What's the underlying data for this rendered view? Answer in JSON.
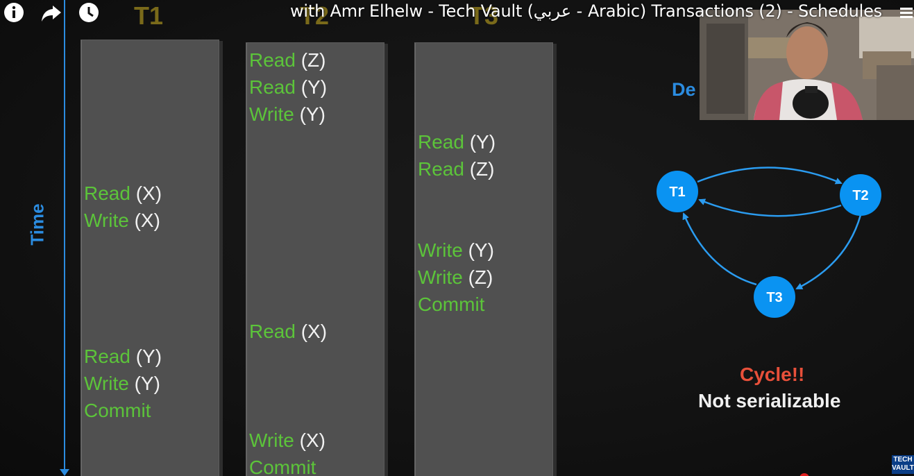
{
  "overlay": {
    "title": "with Amr Elhelw - Tech Vault (عربي - Arabic) Transactions (2) - Schedules",
    "icons": [
      "info-icon",
      "share-icon",
      "watch-later-icon",
      "menu-icon"
    ]
  },
  "time_label": "Time",
  "dependency_label": "De",
  "columns": [
    {
      "header": "T1",
      "ops": [
        {
          "verb": "Read",
          "arg": "(X)"
        },
        {
          "verb": "Write",
          "arg": "(X)"
        },
        {
          "verb": "Read",
          "arg": "(Y)"
        },
        {
          "verb": "Write",
          "arg": "(Y)"
        },
        {
          "verb": "Commit",
          "arg": ""
        }
      ]
    },
    {
      "header": "T2",
      "ops": [
        {
          "verb": "Read",
          "arg": "(Z)"
        },
        {
          "verb": "Read",
          "arg": "(Y)"
        },
        {
          "verb": "Write",
          "arg": "(Y)"
        },
        {
          "verb": "Read",
          "arg": "(X)"
        },
        {
          "verb": "Write",
          "arg": "(X)"
        },
        {
          "verb": "Commit",
          "arg": ""
        }
      ]
    },
    {
      "header": "T3",
      "ops": [
        {
          "verb": "Read",
          "arg": "(Y)"
        },
        {
          "verb": "Read",
          "arg": "(Z)"
        },
        {
          "verb": "Write",
          "arg": "(Y)"
        },
        {
          "verb": "Write",
          "arg": "(Z)"
        },
        {
          "verb": "Commit",
          "arg": ""
        }
      ]
    }
  ],
  "graph": {
    "nodes": [
      "T1",
      "T2",
      "T3"
    ],
    "edges": [
      {
        "from": "T1",
        "to": "T2"
      },
      {
        "from": "T2",
        "to": "T1"
      },
      {
        "from": "T2",
        "to": "T3"
      },
      {
        "from": "T3",
        "to": "T1"
      }
    ]
  },
  "result": {
    "cycle": "Cycle!!",
    "verdict": "Not serializable"
  },
  "watermark": {
    "line1": "TECH",
    "line2": "VAULT"
  },
  "colors": {
    "background": "#121212",
    "column": "#505050",
    "verb": "#5cc43a",
    "arg": "#f2f2f2",
    "accent_blue": "#2b8ce0",
    "node": "#0a93f2",
    "cycle": "#e8503a",
    "header": "#7a6a1a"
  }
}
